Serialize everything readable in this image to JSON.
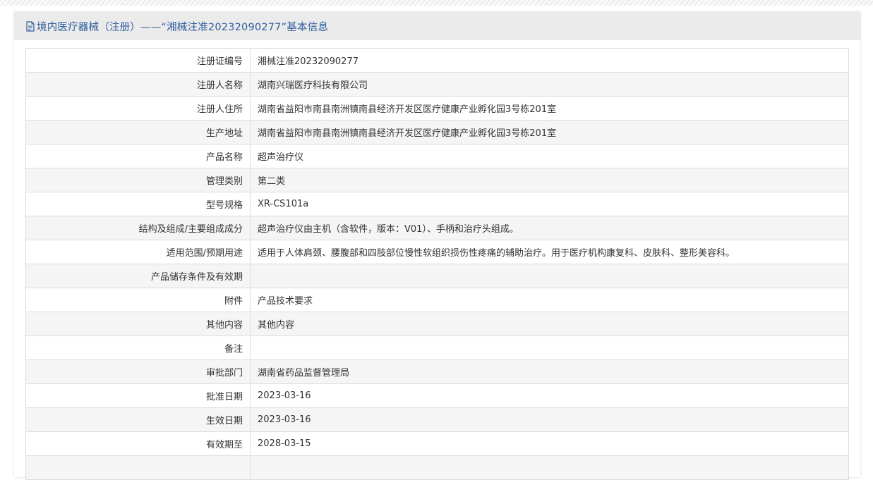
{
  "header": {
    "title": "境内医疗器械（注册）——“湘械注准20232090277”基本信息",
    "icon": "document-icon"
  },
  "rows": [
    {
      "label": "注册证编号",
      "value": "湘械注准20232090277"
    },
    {
      "label": "注册人名称",
      "value": "湖南兴瑞医疗科技有限公司"
    },
    {
      "label": "注册人住所",
      "value": "湖南省益阳市南县南洲镇南县经济开发区医疗健康产业孵化园3号栋201室"
    },
    {
      "label": "生产地址",
      "value": "湖南省益阳市南县南洲镇南县经济开发区医疗健康产业孵化园3号栋201室"
    },
    {
      "label": "产品名称",
      "value": "超声治疗仪"
    },
    {
      "label": "管理类别",
      "value": "第二类"
    },
    {
      "label": "型号规格",
      "value": "XR-CS101a"
    },
    {
      "label": "结构及组成/主要组成成分",
      "value": "超声治疗仪由主机（含软件，版本：V01）、手柄和治疗头组成。"
    },
    {
      "label": "适用范围/预期用途",
      "value": "适用于人体肩颈、腰腹部和四肢部位慢性软组织损伤性疼痛的辅助治疗。用于医疗机构康复科、皮肤科、整形美容科。"
    },
    {
      "label": "产品储存条件及有效期",
      "value": ""
    },
    {
      "label": "附件",
      "value": "产品技术要求"
    },
    {
      "label": "其他内容",
      "value": "其他内容"
    },
    {
      "label": "备注",
      "value": ""
    },
    {
      "label": "审批部门",
      "value": "湖南省药品监督管理局"
    },
    {
      "label": "批准日期",
      "value": "2023-03-16"
    },
    {
      "label": "生效日期",
      "value": "2023-03-16"
    },
    {
      "label": "有效期至",
      "value": "2028-03-15"
    },
    {
      "label": "",
      "value": ""
    }
  ]
}
